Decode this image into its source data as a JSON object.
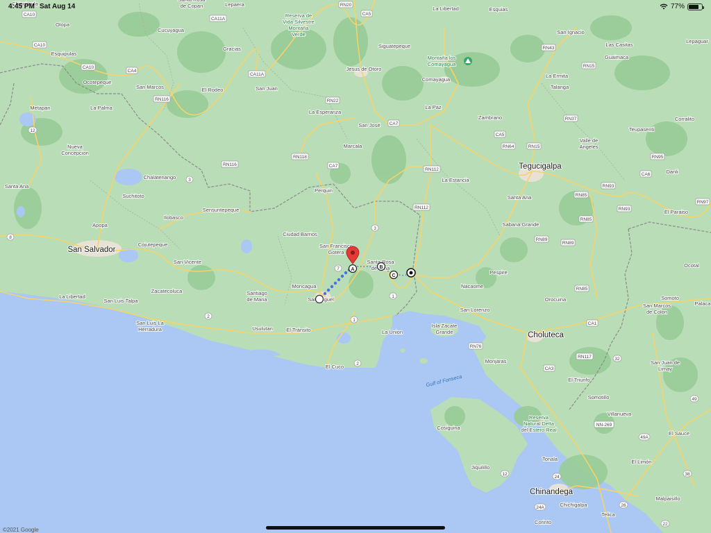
{
  "status_bar": {
    "time": "4:45 PM",
    "date": "Sat Aug 14",
    "battery_text": "77%",
    "battery_level": 0.77
  },
  "copyright": "©2021 Google",
  "colors": {
    "land": "#b9ddb6",
    "forest": "#98cc97",
    "water": "#aac8f3",
    "road": "#f6d36a",
    "route": "#4a6fe3",
    "pin": "#e53935"
  },
  "places": [
    {
      "id": "chiquimula",
      "label": "Chiquimula"
    },
    {
      "id": "olopa",
      "label": "Olopa"
    },
    {
      "id": "esquipulas",
      "label": "Esquipulas"
    },
    {
      "id": "ocotepeque",
      "label": "Ocotepeque"
    },
    {
      "id": "metapan",
      "label": "Metapan"
    },
    {
      "id": "la-palma",
      "label": "La Palma"
    },
    {
      "id": "nueva-concepcion",
      "label": "Nueva\nConcepcion"
    },
    {
      "id": "santa-ana",
      "label": "Santa Ana"
    },
    {
      "id": "chalatenango",
      "label": "Chalatenango"
    },
    {
      "id": "suchitoto",
      "label": "Suchitoto"
    },
    {
      "id": "apopa",
      "label": "Apopa"
    },
    {
      "id": "san-salvador",
      "label": "San Salvador",
      "major": true
    },
    {
      "id": "cojutepeque",
      "label": "Cojutepeque"
    },
    {
      "id": "ilobasco",
      "label": "Ilobasco"
    },
    {
      "id": "sensuntepeque",
      "label": "Sensuntepeque"
    },
    {
      "id": "san-vicente",
      "label": "San Vicente"
    },
    {
      "id": "zacatecoluca",
      "label": "Zacatecoluca"
    },
    {
      "id": "la-libertad",
      "label": "La Libertad"
    },
    {
      "id": "san-luis-talpa",
      "label": "San Luis Talpa"
    },
    {
      "id": "san-luis-herradura",
      "label": "San Luis La\nHerradura"
    },
    {
      "id": "usulutan",
      "label": "Usulutan"
    },
    {
      "id": "el-transito",
      "label": "El Tránsito"
    },
    {
      "id": "santiago-de-maria",
      "label": "Santiago\nde Maria"
    },
    {
      "id": "moncagua",
      "label": "Moncagua"
    },
    {
      "id": "san-miguel",
      "label": "San Miguel"
    },
    {
      "id": "ciudad-barrios",
      "label": "Ciudad Barrios"
    },
    {
      "id": "perquin",
      "label": "Perquin"
    },
    {
      "id": "san-francisco-gotera",
      "label": "San Francisco\nGotera"
    },
    {
      "id": "santa-rosa-de-lima",
      "label": "Santa Rosa\nde Lima"
    },
    {
      "id": "la-union",
      "label": "La Union"
    },
    {
      "id": "el-cuco",
      "label": "El Cuco"
    },
    {
      "id": "santa-rosa-copan",
      "label": "Santa Rosa\nde Copan"
    },
    {
      "id": "lepaera",
      "label": "Lepaera"
    },
    {
      "id": "cucuyagua",
      "label": "Cucuyagua"
    },
    {
      "id": "gracias",
      "label": "Gracias"
    },
    {
      "id": "san-marcos",
      "label": "San Marcos"
    },
    {
      "id": "el-rodeo",
      "label": "El Rodeo"
    },
    {
      "id": "san-juan",
      "label": "San Juan"
    },
    {
      "id": "la-esperanza",
      "label": "La Esperanza"
    },
    {
      "id": "san-jose",
      "label": "San José"
    },
    {
      "id": "marcala",
      "label": "Marcala"
    },
    {
      "id": "reserva-montana-verde",
      "label": "Reserva de\nVida Silvestre\nMontaña\nVerde"
    },
    {
      "id": "siguatepeque",
      "label": "Siguatepeque"
    },
    {
      "id": "jesus-de-otoro",
      "label": "Jesus de Otoro"
    },
    {
      "id": "la-libertad-hn",
      "label": "La Libertad"
    },
    {
      "id": "esquias",
      "label": "Esquias"
    },
    {
      "id": "montana-comayagua",
      "label": "Montaña los\nComayagua"
    },
    {
      "id": "comayagua",
      "label": "Comayagua"
    },
    {
      "id": "la-paz",
      "label": "La Paz"
    },
    {
      "id": "zambrano",
      "label": "Zambrano"
    },
    {
      "id": "san-ignacio",
      "label": "San Ignacio"
    },
    {
      "id": "las-casitas",
      "label": "Las Casitas"
    },
    {
      "id": "guaimaca",
      "label": "Guaimaca"
    },
    {
      "id": "lepaguare",
      "label": "Lepaguar"
    },
    {
      "id": "la-ermita",
      "label": "La Ermita"
    },
    {
      "id": "talanga",
      "label": "Talanga"
    },
    {
      "id": "teupasenti",
      "label": "Teupasenti"
    },
    {
      "id": "corralito",
      "label": "Corralito"
    },
    {
      "id": "valle-de-angeles",
      "label": "Valle de\nAngeles"
    },
    {
      "id": "tegucigalpa",
      "label": "Tegucigalpa",
      "major": true
    },
    {
      "id": "danli",
      "label": "Danli"
    },
    {
      "id": "la-estancia",
      "label": "La Estancia"
    },
    {
      "id": "santa-ana-hn",
      "label": "Santa Ana"
    },
    {
      "id": "el-paraiso",
      "label": "El Paraiso"
    },
    {
      "id": "sabana-grande",
      "label": "Sabana Grande"
    },
    {
      "id": "pespire",
      "label": "Pespire"
    },
    {
      "id": "nacaome",
      "label": "Nacaome"
    },
    {
      "id": "ocotal",
      "label": "Ocotal"
    },
    {
      "id": "orocuina",
      "label": "Orocuina"
    },
    {
      "id": "somoto",
      "label": "Somoto"
    },
    {
      "id": "palacag",
      "label": "Palaca"
    },
    {
      "id": "san-lorenzo",
      "label": "San Lorenzo"
    },
    {
      "id": "san-marcos-colon",
      "label": "San Marcos\nde Colon"
    },
    {
      "id": "isla-zacate-grande",
      "label": "Isla Zacate\nGrande"
    },
    {
      "id": "choluteca",
      "label": "Choluteca",
      "major": true
    },
    {
      "id": "monjaras",
      "label": "Monjaras"
    },
    {
      "id": "el-triunfo",
      "label": "El Triunfo"
    },
    {
      "id": "san-juan-limay",
      "label": "San Juan de\nLimay"
    },
    {
      "id": "somotillo",
      "label": "Somotillo"
    },
    {
      "id": "villanueva",
      "label": "Villanueva"
    },
    {
      "id": "reserva-estero-real",
      "label": "Reserva\nNatural Delta\ndel Estero Real"
    },
    {
      "id": "gulf-of-fonseca",
      "label": "Gulf of Fonseca"
    },
    {
      "id": "cosiguina",
      "label": "Cosiguina"
    },
    {
      "id": "el-sauce",
      "label": "El Sauce"
    },
    {
      "id": "tonala",
      "label": "Tonala"
    },
    {
      "id": "el-limon",
      "label": "El Limón"
    },
    {
      "id": "jiquilillo",
      "label": "Jiquilillo"
    },
    {
      "id": "chinandega",
      "label": "Chinandega",
      "major": true
    },
    {
      "id": "chichigalpa",
      "label": "Chichigalpa"
    },
    {
      "id": "malpaisillo",
      "label": "Malpaisillo"
    },
    {
      "id": "corinto",
      "label": "Corinto"
    },
    {
      "id": "telica",
      "label": "Telica"
    }
  ],
  "shields": [
    {
      "id": "ca10-top",
      "label": "CA10"
    },
    {
      "id": "ca10-a",
      "label": "CA10"
    },
    {
      "id": "ca10-b",
      "label": "CA10"
    },
    {
      "id": "ca4",
      "label": "CA4"
    },
    {
      "id": "ca11a-top",
      "label": "CA11A"
    },
    {
      "id": "ca11a",
      "label": "CA11A"
    },
    {
      "id": "rn116-a",
      "label": "RN116"
    },
    {
      "id": "rn116-b",
      "label": "RN116"
    },
    {
      "id": "rn20",
      "label": "RN20"
    },
    {
      "id": "ca5-top",
      "label": "CA5"
    },
    {
      "id": "rn22",
      "label": "RN22"
    },
    {
      "id": "rn118",
      "label": "RN118"
    },
    {
      "id": "ca7-a",
      "label": "CA7"
    },
    {
      "id": "ca7-b",
      "label": "CA7"
    },
    {
      "id": "rn112-a",
      "label": "RN112"
    },
    {
      "id": "rn112-b",
      "label": "RN112"
    },
    {
      "id": "ca5",
      "label": "CA5"
    },
    {
      "id": "rn64",
      "label": "RN64"
    },
    {
      "id": "rn15-a",
      "label": "RN15"
    },
    {
      "id": "rn15-b",
      "label": "RN15"
    },
    {
      "id": "rn43",
      "label": "RN43"
    },
    {
      "id": "rn37",
      "label": "RN37"
    },
    {
      "id": "rn95",
      "label": "RN95"
    },
    {
      "id": "ca6",
      "label": "CA6"
    },
    {
      "id": "rn93-a",
      "label": "RN93"
    },
    {
      "id": "rn93-b",
      "label": "RN93"
    },
    {
      "id": "rn97",
      "label": "RN97"
    },
    {
      "id": "rn85-a",
      "label": "RN85"
    },
    {
      "id": "rn85-b",
      "label": "RN85"
    },
    {
      "id": "rn85-c",
      "label": "RN85"
    },
    {
      "id": "rn89-a",
      "label": "RN89"
    },
    {
      "id": "rn89-b",
      "label": "RN89"
    },
    {
      "id": "ca1-hn",
      "label": "CA1"
    },
    {
      "id": "rn76",
      "label": "RN76"
    },
    {
      "id": "rn117",
      "label": "RN117"
    },
    {
      "id": "ca3",
      "label": "CA3"
    },
    {
      "id": "nn269",
      "label": "NN-269"
    },
    {
      "id": "r12",
      "label": "12"
    },
    {
      "id": "r8",
      "label": "8"
    },
    {
      "id": "r3-a",
      "label": "3"
    },
    {
      "id": "r3-b",
      "label": "3"
    },
    {
      "id": "r7",
      "label": "7"
    },
    {
      "id": "r1-a",
      "label": "1"
    },
    {
      "id": "r1-b",
      "label": "1"
    },
    {
      "id": "r2-a",
      "label": "2"
    },
    {
      "id": "r2-b",
      "label": "2"
    },
    {
      "id": "r32",
      "label": "32"
    },
    {
      "id": "r49",
      "label": "49"
    },
    {
      "id": "r49a",
      "label": "49A"
    },
    {
      "id": "r38",
      "label": "38"
    },
    {
      "id": "r24",
      "label": "24"
    },
    {
      "id": "r24a",
      "label": "24A"
    },
    {
      "id": "r26",
      "label": "26"
    },
    {
      "id": "r22",
      "label": "22"
    },
    {
      "id": "r12-ni",
      "label": "12"
    }
  ],
  "route": {
    "waypoints": [
      {
        "id": "origin",
        "label": ""
      },
      {
        "id": "stop-a",
        "label": "A"
      },
      {
        "id": "stop-b",
        "label": "B"
      },
      {
        "id": "stop-c",
        "label": "C"
      },
      {
        "id": "destination",
        "label": ""
      }
    ]
  }
}
